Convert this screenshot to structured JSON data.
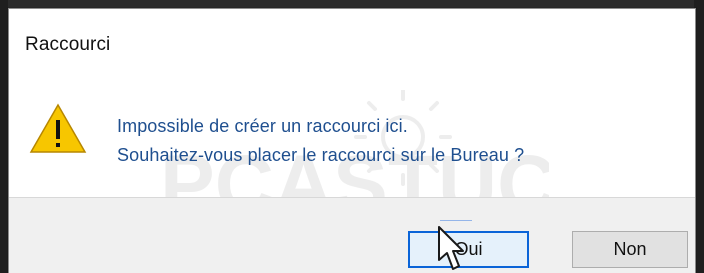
{
  "dialog": {
    "title": "Raccourci",
    "message_line_1": "Impossible de créer un raccourci ici.",
    "message_line_2": "Souhaitez-vous placer le raccourci sur le Bureau ?",
    "buttons": {
      "yes": "Oui",
      "no": "Non"
    },
    "icon": "warning-icon",
    "cursor_icon": "mouse-pointer-icon",
    "colors": {
      "title": "#111111",
      "message": "#1f4f8f",
      "primary_button_border": "#0a64d8",
      "warning": "#f7c600",
      "background": "#ffffff",
      "footer": "#f0f0f0"
    },
    "watermark": "PCASTUCES"
  }
}
